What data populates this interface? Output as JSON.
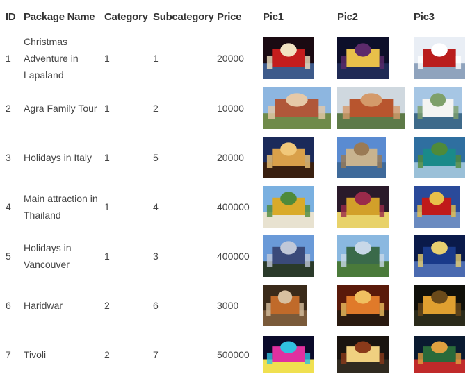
{
  "table": {
    "headers": {
      "id": "ID",
      "name": "Package Name",
      "category": "Category",
      "subcategory": "Subcategory",
      "price": "Price",
      "pic1": "Pic1",
      "pic2": "Pic2",
      "pic3": "Pic3"
    },
    "rows": [
      {
        "id": "1",
        "name": "Christmas Adventure in Lapaland",
        "category": "1",
        "subcategory": "1",
        "price": "20000",
        "pic1": "christmas-santa-photo",
        "pic2": "christmas-market-photo",
        "pic3": "snow-house-photo"
      },
      {
        "id": "2",
        "name": "Agra Family Tour",
        "category": "1",
        "subcategory": "2",
        "price": "10000",
        "pic1": "humayun-tomb-photo",
        "pic2": "red-fort-photo",
        "pic3": "taj-mahal-photo"
      },
      {
        "id": "3",
        "name": "Holidays in Italy",
        "category": "1",
        "subcategory": "5",
        "price": "20000",
        "pic1": "colosseum-photo",
        "pic2": "italian-city-photo",
        "pic3": "lake-coast-photo"
      },
      {
        "id": "4",
        "name": "Main attraction in Thailand",
        "category": "1",
        "subcategory": "4",
        "price": "400000",
        "pic1": "thai-temple-photo",
        "pic2": "thai-festival-photo",
        "pic3": "thai-shrine-photo"
      },
      {
        "id": "5",
        "name": "Holidays in Vancouver",
        "category": "1",
        "subcategory": "3",
        "price": "400000",
        "pic1": "science-world-photo",
        "pic2": "vancouver-skyline-photo",
        "pic3": "vancouver-night-photo"
      },
      {
        "id": "6",
        "name": "Haridwar",
        "category": "2",
        "subcategory": "6",
        "price": "3000",
        "pic1": "haridwar-ghat-photo",
        "pic2": "ganga-aarti-photo",
        "pic3": "river-lights-photo"
      },
      {
        "id": "7",
        "name": "Tivoli",
        "category": "2",
        "subcategory": "7",
        "price": "500000",
        "pic1": "tivoli-lights-photo",
        "pic2": "tivoli-ride-photo",
        "pic3": "tivoli-pagoda-photo"
      }
    ]
  }
}
